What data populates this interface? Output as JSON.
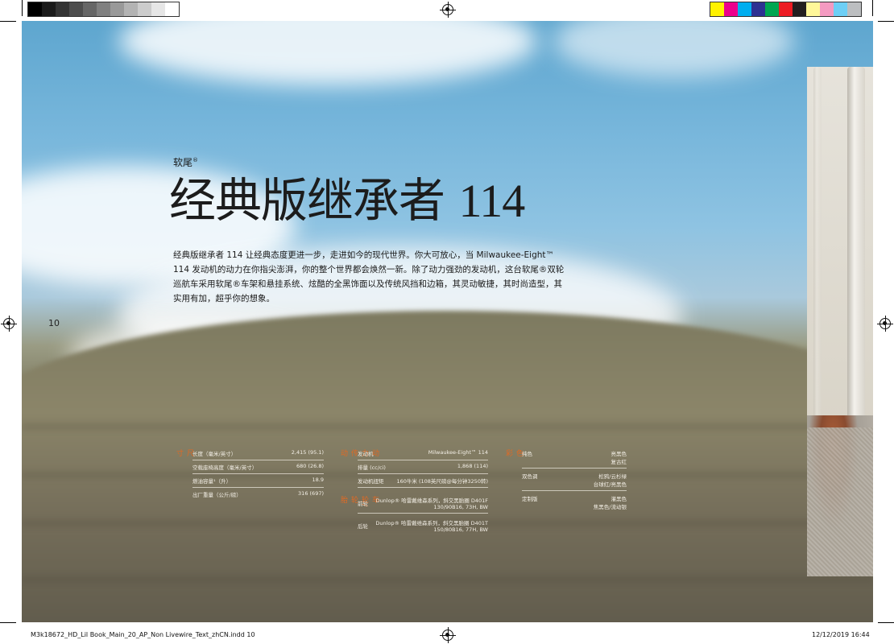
{
  "print_marks": {
    "gray_swatches": [
      "#000000",
      "#1a1a1a",
      "#333333",
      "#4d4d4d",
      "#666666",
      "#808080",
      "#999999",
      "#b3b3b3",
      "#cccccc",
      "#e6e6e6",
      "#ffffff"
    ],
    "color_swatches": [
      "#fff200",
      "#ec008c",
      "#00aeef",
      "#2e3192",
      "#00a651",
      "#ed1c24",
      "#231f20",
      "#fff799",
      "#f49ac1",
      "#6dcff6",
      "#bcbec0"
    ]
  },
  "page": {
    "model_family": "软尾",
    "model_family_mark": "®",
    "title": "经典版继承者",
    "title_number": "114",
    "intro": "经典版继承者 114 让经典态度更进一步，走进如今的现代世界。你大可放心，当 Milwaukee-Eight™ 114 发动机的动力在你指尖澎湃，你的整个世界都会焕然一新。除了动力强劲的发动机，这台软尾®双轮巡航车采用软尾®车架和悬挂系统、炫酷的全黑饰面以及传统风挡和边箱，其灵动敏捷，其时尚造型，其实用有加，超乎你的想象。",
    "page_number": "10"
  },
  "specs": {
    "dimensions": {
      "label": "尺寸",
      "rows": [
        {
          "k": "长度（毫米/英寸）",
          "v": "2,415 (95.1)"
        },
        {
          "k": "空载座椅高度（毫米/英寸）",
          "v": "680 (26.8)"
        },
        {
          "k": "燃油容量¹（升）",
          "v": "18.9"
        },
        {
          "k": "出厂重量（公斤/磅）",
          "v": "316 (697)"
        }
      ]
    },
    "powertrain": {
      "label": "动力传动",
      "rows": [
        {
          "k": "发动机",
          "v": "Milwaukee-Eight™ 114"
        },
        {
          "k": "排量 (cc/ci)",
          "v": "1,868 (114)"
        },
        {
          "k": "发动机扭矩",
          "v": "160牛米 (108英尺磅@每分钟3250转)"
        }
      ]
    },
    "wheels": {
      "label": "车轮/轮胎",
      "rows": [
        {
          "k": "前轮",
          "v1": "Dunlop® 哈雷戴维森系列，斜交黑胎圈 D401F",
          "v2": "130/90B16, 73H, BW"
        },
        {
          "k": "后轮",
          "v1": "Dunlop® 哈雷戴维森系列，斜交黑胎圈 D401T",
          "v2": "150/80B16, 77H, BW"
        }
      ]
    },
    "colors": {
      "label": "色彩",
      "rows": [
        {
          "k": "纯色",
          "v1": "亮黑色",
          "v2": "复古红"
        },
        {
          "k": "双色调",
          "v1": "松鸦/云杉绿",
          "v2": "台球红/亮黑色"
        },
        {
          "k": "定制版",
          "v1": "灌黑色",
          "v2": "焦黑色/流动银"
        }
      ]
    }
  },
  "slug": {
    "file": "M3k18672_HD_Lil Book_Main_20_AP_Non Livewire_Text_zhCN.indd   10",
    "date": "12/12/2019   16:44"
  }
}
